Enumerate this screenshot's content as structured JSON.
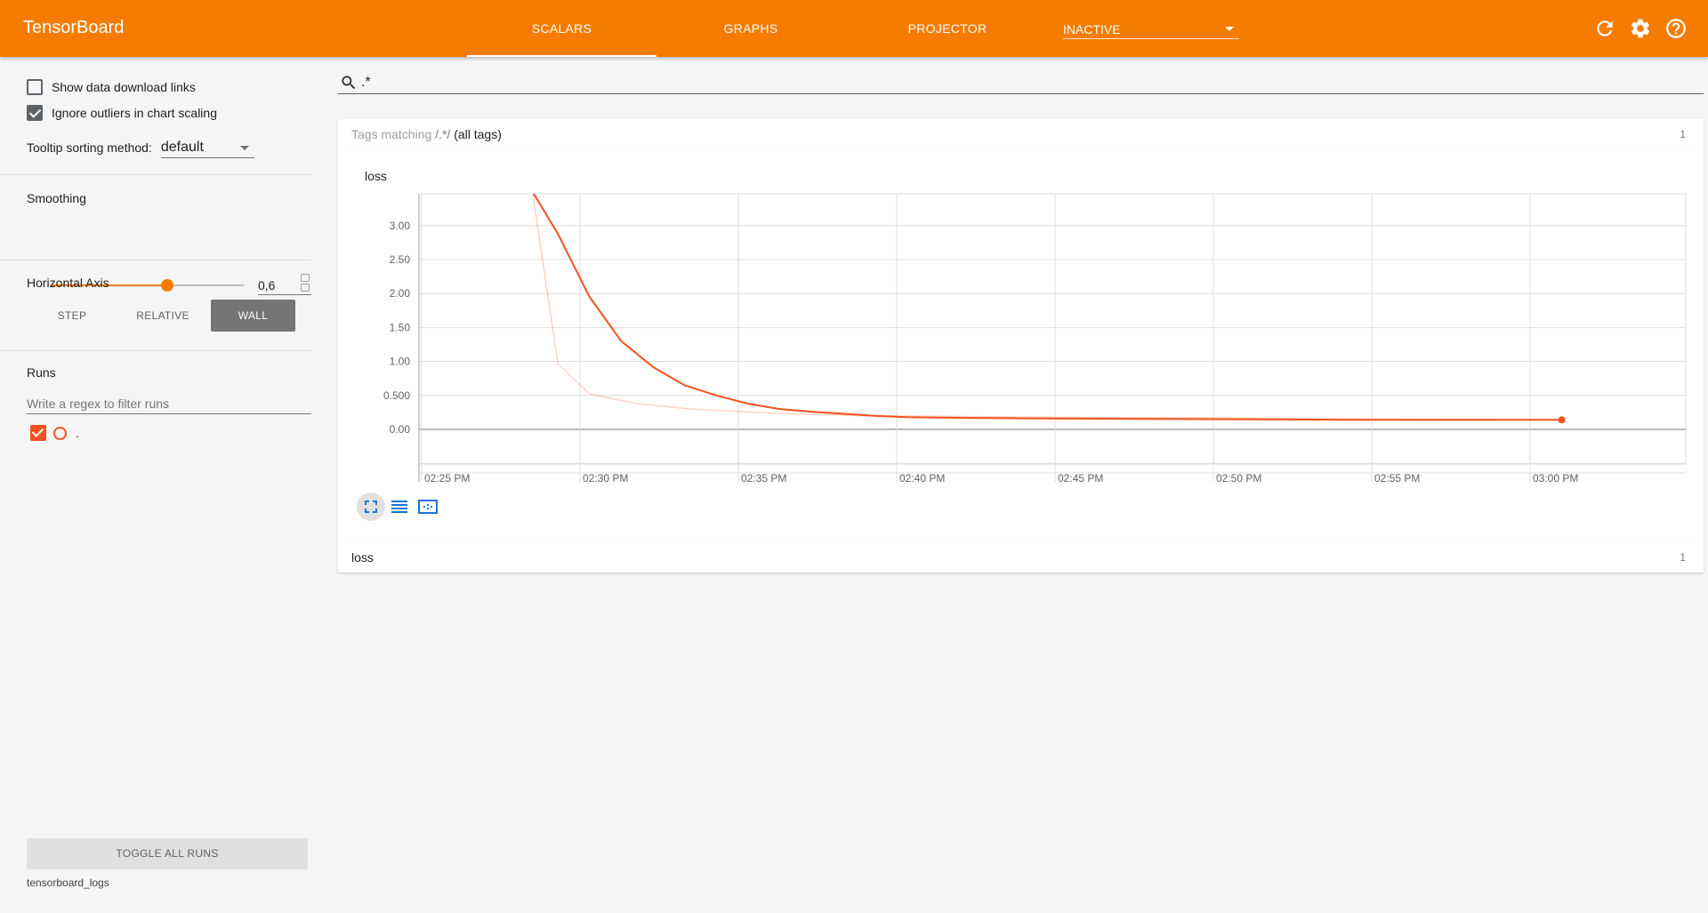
{
  "header": {
    "title": "TensorBoard",
    "tabs": [
      "SCALARS",
      "GRAPHS",
      "PROJECTOR"
    ],
    "active_tab": "SCALARS",
    "inactive_dropdown": "INACTIVE",
    "accent_color": "#f57c00"
  },
  "sidebar": {
    "show_download_links": "Show data download links",
    "show_download_links_checked": false,
    "ignore_outliers": "Ignore outliers in chart scaling",
    "ignore_outliers_checked": true,
    "tooltip_sorting_label": "Tooltip sorting method:",
    "tooltip_sorting_value": "default",
    "smoothing_label": "Smoothing",
    "smoothing_value": "0,6",
    "smoothing_fraction": 0.6,
    "horizontal_axis_label": "Horizontal Axis",
    "axis_options": [
      "STEP",
      "RELATIVE",
      "WALL"
    ],
    "axis_selected": "WALL",
    "runs_label": "Runs",
    "runs_filter_placeholder": "Write a regex to filter runs",
    "runs": [
      {
        "name": ".",
        "checked": true,
        "color": "#f4511e"
      }
    ],
    "toggle_all_runs": "TOGGLE ALL RUNS",
    "logdir": "tensorboard_logs"
  },
  "main": {
    "search_value": ".*",
    "tags_header": {
      "prefix": "Tags matching",
      "regex": "/.*/",
      "suffix": "(all tags)",
      "count": "1"
    },
    "loss_header": {
      "name": "loss",
      "count": "1"
    }
  },
  "chart_data": {
    "type": "line",
    "title": "loss",
    "x_ticks": [
      "02:25 PM",
      "02:30 PM",
      "02:35 PM",
      "02:40 PM",
      "02:45 PM",
      "02:50 PM",
      "02:55 PM",
      "03:00 PM"
    ],
    "y_ticks": [
      "3.00",
      "2.50",
      "2.00",
      "1.50",
      "1.00",
      "0.500",
      "0.00"
    ],
    "xlim_minutes_after_1425": [
      0,
      40
    ],
    "ylim": [
      -0.5,
      3.5
    ],
    "series": [
      {
        "role": "raw",
        "color": "#f4511e",
        "opacity": 0.25,
        "x": [
          3.5,
          4.3,
          5.3,
          6.8,
          8.5,
          11,
          14,
          17,
          20,
          25,
          30,
          35,
          36
        ],
        "y": [
          3.5,
          0.97,
          0.52,
          0.38,
          0.3,
          0.24,
          0.2,
          0.19,
          0.18,
          0.17,
          0.15,
          0.14,
          0.14
        ]
      },
      {
        "role": "smoothed",
        "color": "#f4511e",
        "opacity": 1,
        "x": [
          3.5,
          4.3,
          5.3,
          6.3,
          7.3,
          8.3,
          9.3,
          10.3,
          11.3,
          12.3,
          13.3,
          14.3,
          15.3,
          17,
          20,
          25,
          30,
          35,
          36
        ],
        "y": [
          3.5,
          2.88,
          1.95,
          1.3,
          0.92,
          0.65,
          0.5,
          0.38,
          0.3,
          0.26,
          0.23,
          0.2,
          0.18,
          0.17,
          0.16,
          0.15,
          0.14,
          0.14,
          0.14
        ]
      }
    ],
    "grid": true
  },
  "icons": {
    "refresh": "refresh-icon",
    "settings": "gear-icon",
    "help": "help-icon",
    "search": "search-icon",
    "fit": "fit-domain-icon",
    "log": "log-scale-icon",
    "data": "data-table-icon"
  }
}
